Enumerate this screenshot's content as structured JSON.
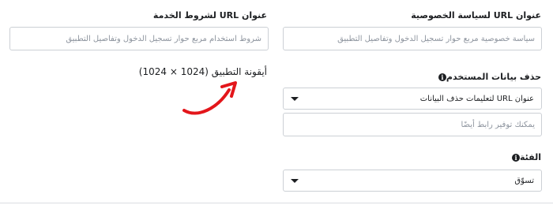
{
  "privacy_policy": {
    "label": "عنوان URL لسياسة الخصوصية",
    "placeholder": "سياسة خصوصية مربع حوار تسجيل الدخول وتفاصيل التطبيق"
  },
  "terms_of_service": {
    "label": "عنوان URL لشروط الخدمة",
    "placeholder": "شروط استخدام مربع حوار تسجيل الدخول وتفاصيل التطبيق"
  },
  "user_data_deletion": {
    "label": "حذف بيانات المستخدم",
    "select_value": "عنوان URL لتعليمات حذف البيانات",
    "input_placeholder": "يمكنك توفير رابط أيضًا"
  },
  "app_icon": {
    "label": "أيقونة التطبيق (1024 × 1024)"
  },
  "category": {
    "label": "الفئة",
    "select_value": "تسوّق"
  },
  "colors": {
    "annotation_arrow": "#e3161b"
  }
}
